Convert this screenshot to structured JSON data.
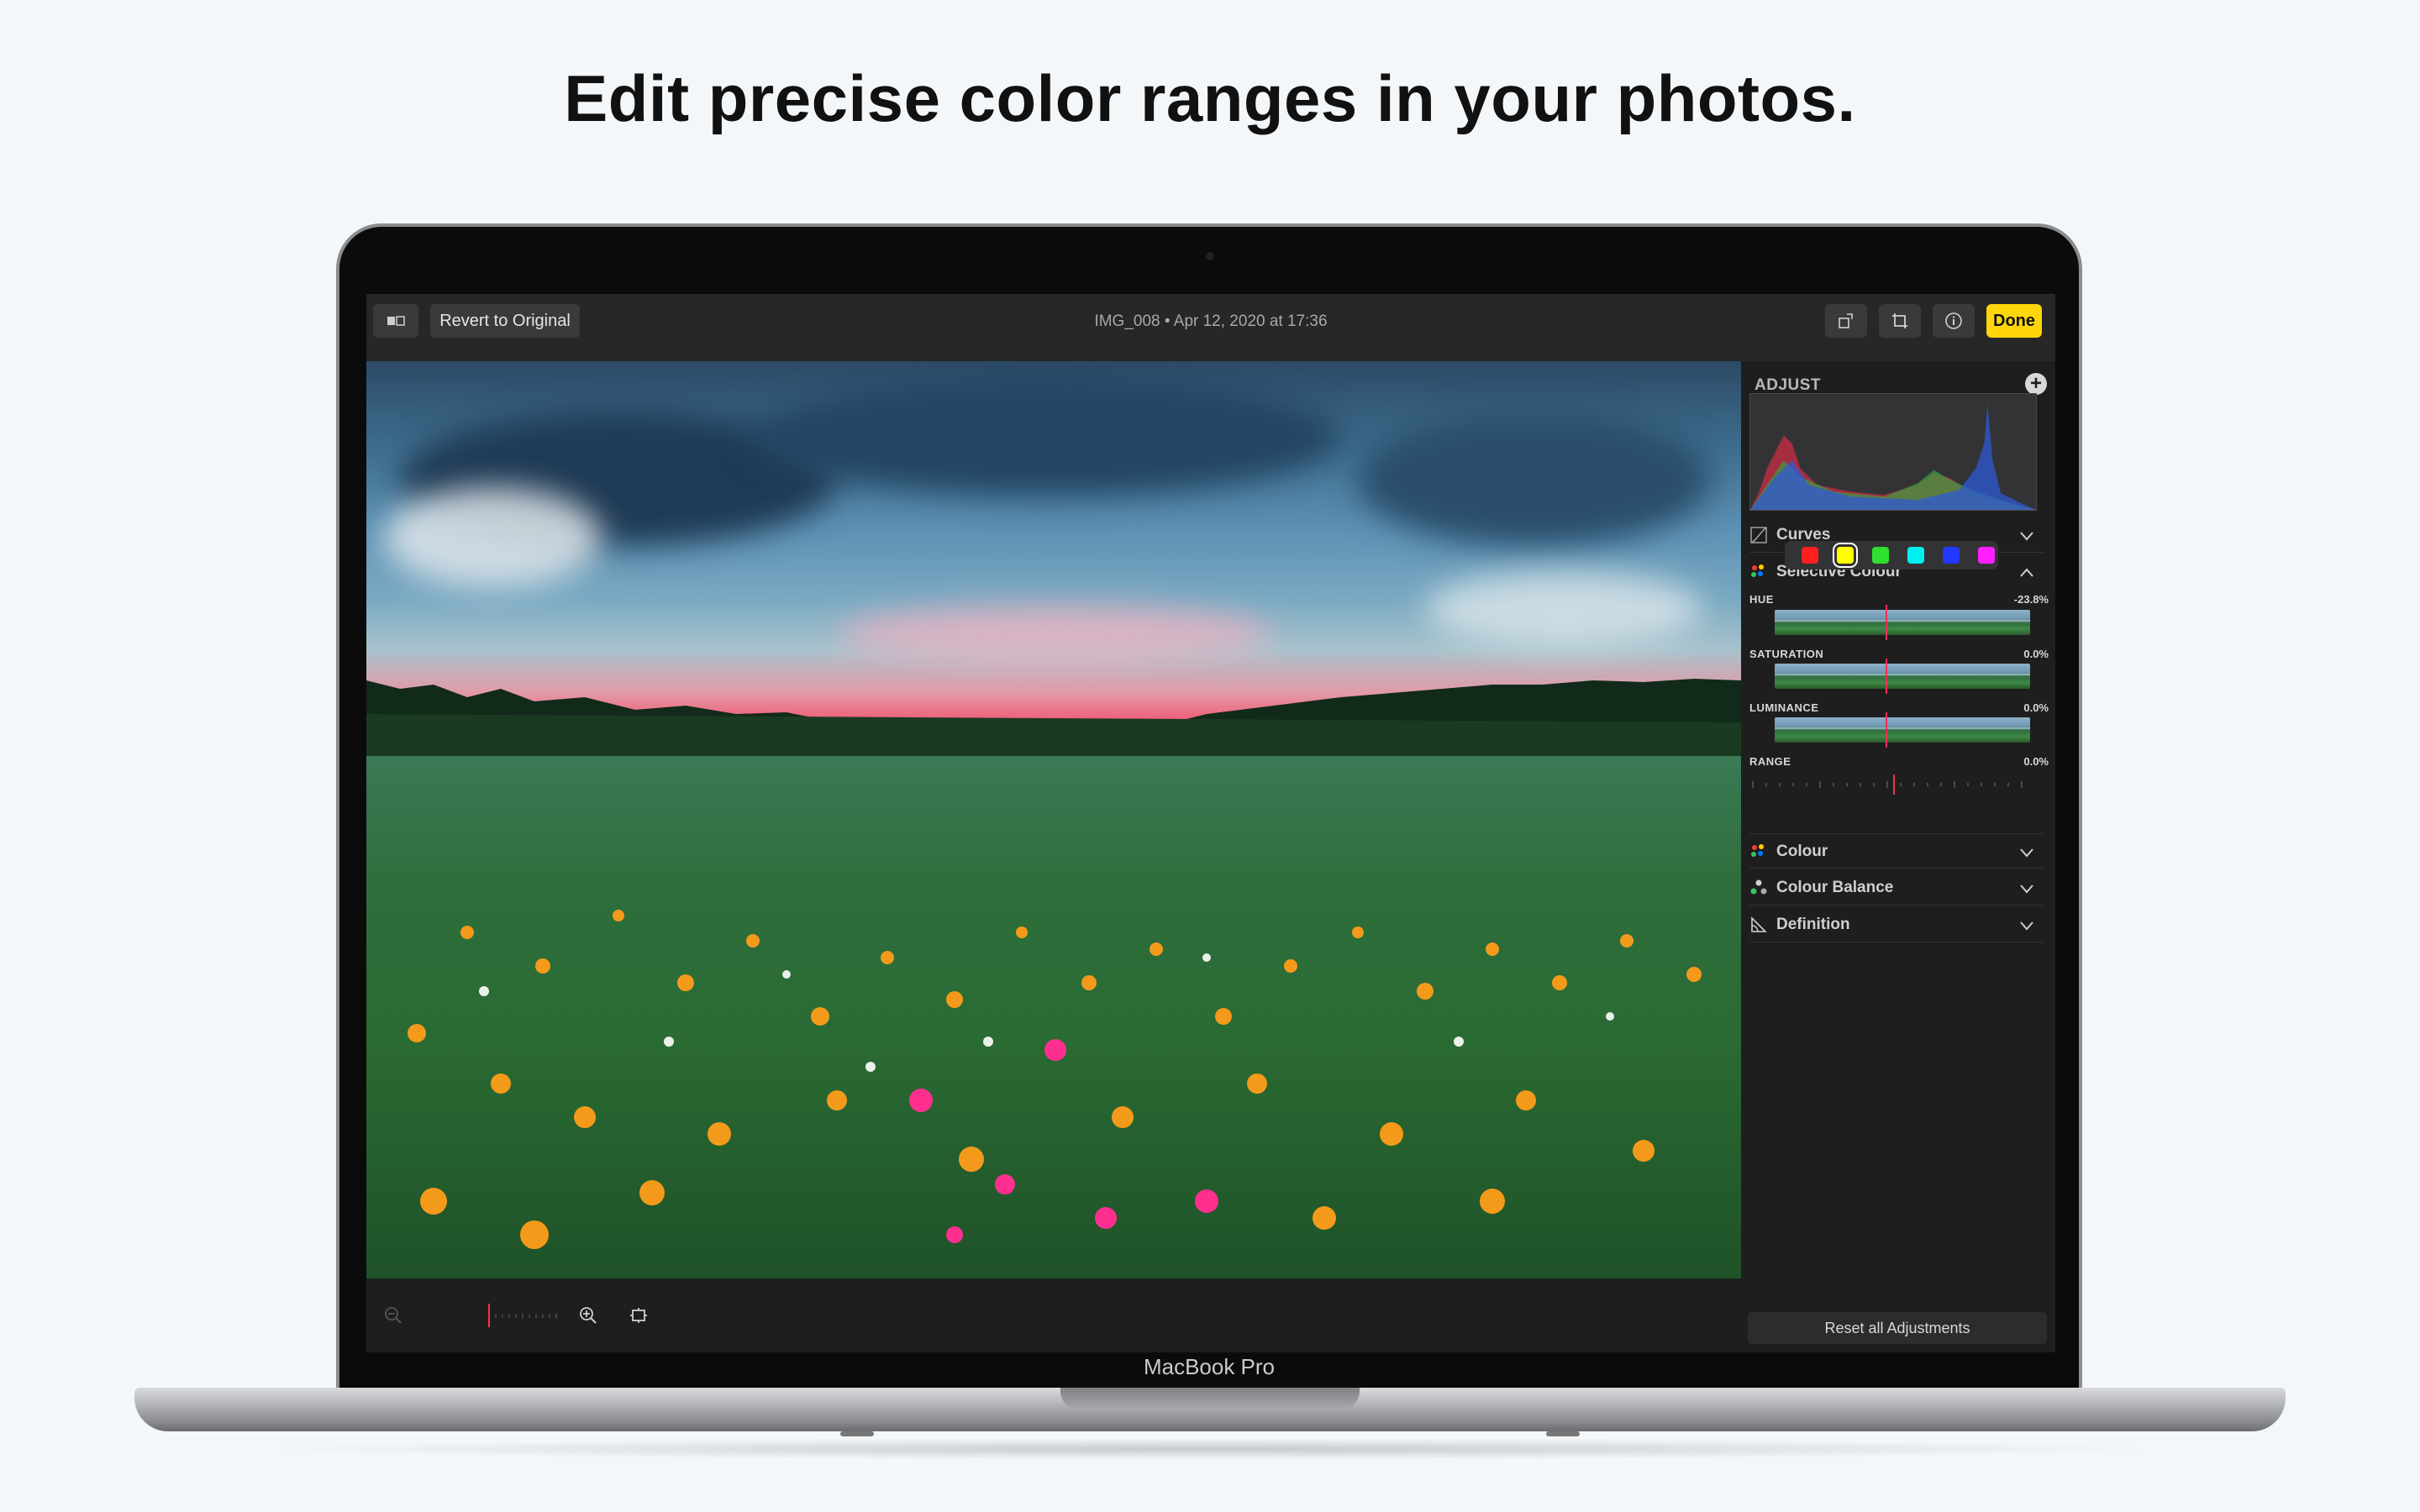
{
  "headline": "Edit precise color ranges in your photos.",
  "device_label": "MacBook Pro",
  "toolbar": {
    "revert_label": "Revert to Original",
    "title": "IMG_008 • Apr 12, 2020 at 17:36",
    "done_label": "Done",
    "icons": [
      "compare-icon",
      "rotate-icon",
      "crop-icon",
      "info-icon"
    ]
  },
  "panel": {
    "title": "ADJUST",
    "sections": {
      "curves": "Curves",
      "selective_colour": "Selective Colour",
      "colour": "Colour",
      "colour_balance": "Colour Balance",
      "definition": "Definition"
    },
    "swatches": [
      {
        "color": "#ff1f1f",
        "selected": false
      },
      {
        "color": "#ffff00",
        "selected": true
      },
      {
        "color": "#2fe02f",
        "selected": false
      },
      {
        "color": "#00f0f0",
        "selected": false
      },
      {
        "color": "#2338ff",
        "selected": false
      },
      {
        "color": "#ff1fff",
        "selected": false
      }
    ],
    "sliders": [
      {
        "label": "HUE",
        "value": "-23.8%"
      },
      {
        "label": "SATURATION",
        "value": "0.0%"
      },
      {
        "label": "LUMINANCE",
        "value": "0.0%"
      },
      {
        "label": "RANGE",
        "value": "0.0%"
      }
    ],
    "reset_label": "Reset all Adjustments"
  },
  "colors": {
    "accent_done": "#ffd60a",
    "marker": "#ff2d55",
    "panel_bg": "#1e1e1f"
  }
}
